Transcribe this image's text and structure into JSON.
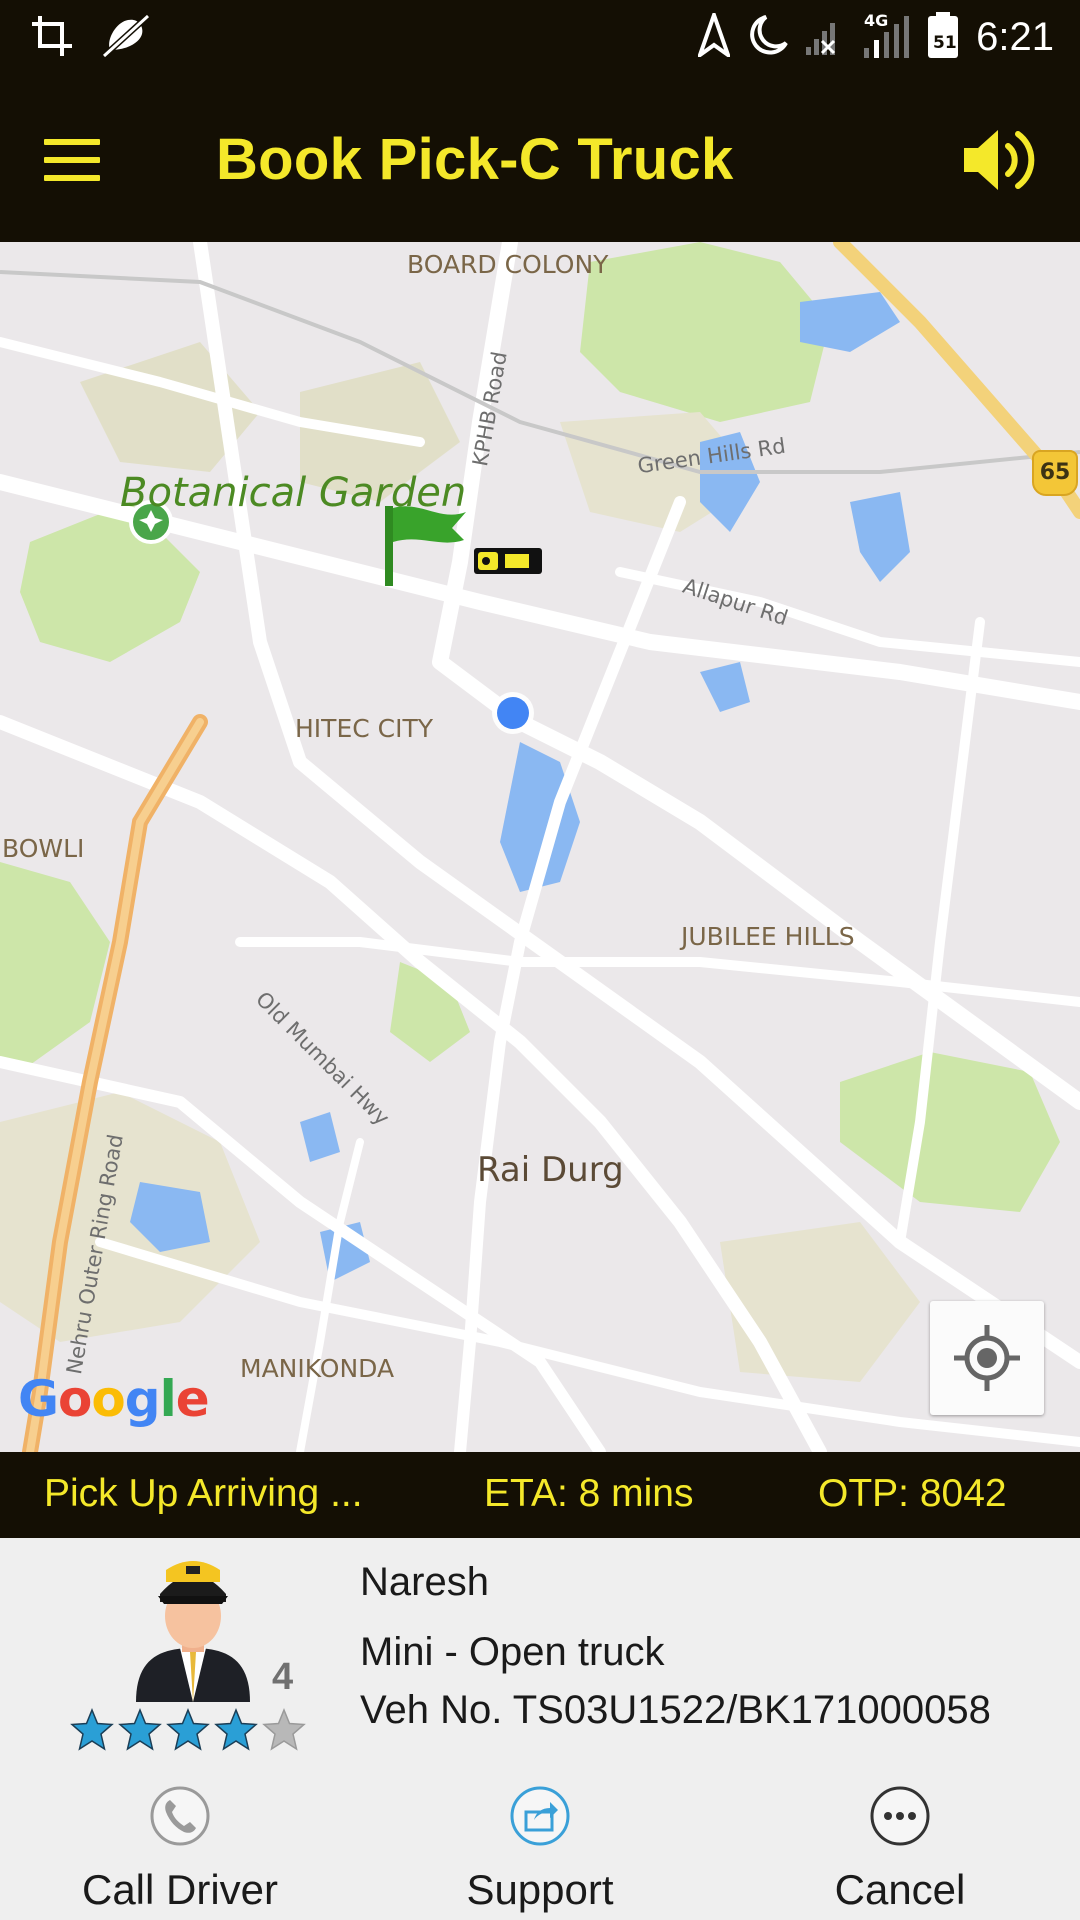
{
  "status_bar": {
    "time": "6:21",
    "network": "4G",
    "left_icons": [
      "crop-icon",
      "notification-off-icon"
    ],
    "right_icons": [
      "navigation-icon",
      "do-not-disturb-moon-icon",
      "signal-no-sim-icon",
      "signal-4g-icon",
      "battery-icon"
    ],
    "battery_level": "51"
  },
  "app_bar": {
    "title": "Book Pick-C Truck",
    "accent_color": "#f4e82a",
    "background_color": "#140f04"
  },
  "map": {
    "labels": {
      "botanical_garden": "Botanical Garden",
      "board_colony": "BOARD COLONY",
      "hitec_city": "HITEC CITY",
      "bowli": "BOWLI",
      "jubilee_hills": "JUBILEE HILLS",
      "rai_durg": "Rai Durg",
      "manikonda": "MANIKONDA",
      "green_hills_rd": "Green Hills Rd",
      "allapur_rd": "Allapur Rd",
      "kphb_road": "KPHB Road",
      "old_mumbai_hwy": "Old Mumbai Hwy",
      "outer_ring_road": "Nehru Outer Ring Road",
      "highway_shield": "65"
    },
    "google_logo": {
      "letters": [
        "G",
        "o",
        "o",
        "g",
        "l",
        "e"
      ],
      "colors": [
        "#4285f4",
        "#ea4335",
        "#fbbc05",
        "#4285f4",
        "#34a853",
        "#ea4335"
      ]
    }
  },
  "trip_info": {
    "status": "Pick Up Arriving ...",
    "eta": "ETA: 8 mins",
    "otp": "OTP: 8042"
  },
  "driver": {
    "name": "Naresh",
    "vehicle_type": "Mini - Open truck",
    "vehicle_number": "Veh No. TS03U1522/BK171000058",
    "rating": "4",
    "rating_value": 4,
    "rating_max": 5,
    "star_color": "#2a9fd6"
  },
  "actions": {
    "call": "Call Driver",
    "support": "Support",
    "cancel": "Cancel"
  }
}
